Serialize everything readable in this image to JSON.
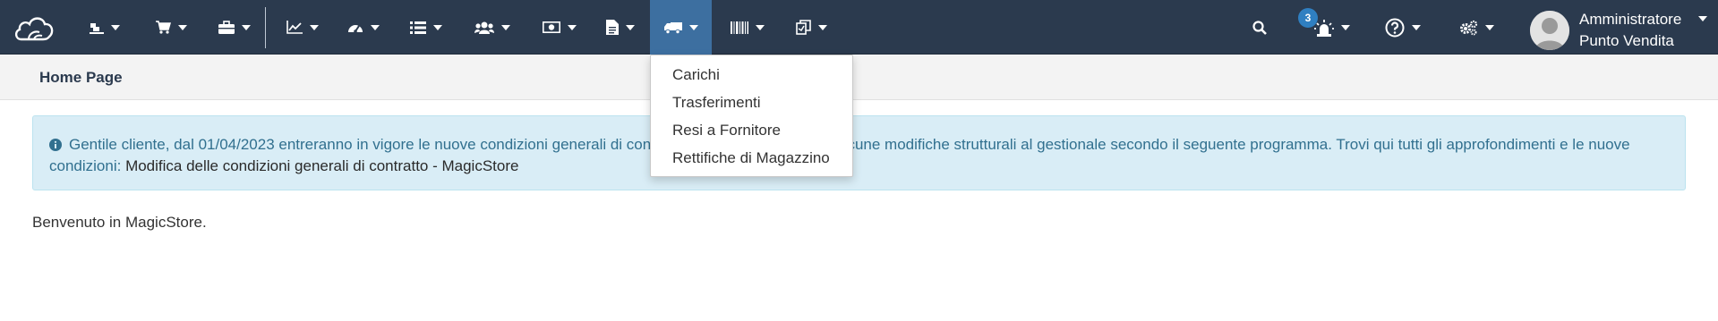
{
  "navbar": {
    "bg_color": "#2b3a4e",
    "active_color": "#3d6fa0",
    "logo_icon": "cloud-logo-icon",
    "items": [
      {
        "icon": "conveyor-icon"
      },
      {
        "icon": "shopping-cart-icon"
      },
      {
        "icon": "briefcase-icon"
      },
      {
        "icon": "line-chart-icon"
      },
      {
        "icon": "dashboard-gauge-icon"
      },
      {
        "icon": "list-icon"
      },
      {
        "icon": "users-icon"
      },
      {
        "icon": "money-bill-icon"
      },
      {
        "icon": "document-icon"
      },
      {
        "icon": "truck-icon",
        "active": true
      },
      {
        "icon": "barcode-icon"
      },
      {
        "icon": "clipboard-copy-icon"
      }
    ],
    "right_items": [
      {
        "icon": "search-icon"
      },
      {
        "icon": "alarm-light-icon",
        "badge": "3"
      },
      {
        "icon": "help-circle-icon"
      },
      {
        "icon": "gears-icon"
      }
    ],
    "user": {
      "role": "Amministratore",
      "store": "Punto Vendita"
    }
  },
  "breadcrumb": {
    "title": "Home Page"
  },
  "alert": {
    "text": "Gentile cliente, dal 01/04/2023 entreranno in vigore le nuove condizioni generali di contratto e verranno apportate alcune modifiche strutturali al gestionale secondo il seguente programma. Trovi qui tutti gli approfondimenti e le nuove condizioni: ",
    "link_text": "Modifica delle condizioni generali di contratto - MagicStore"
  },
  "welcome": "Benvenuto in MagicStore.",
  "dropdown": {
    "items": [
      {
        "label": "Carichi"
      },
      {
        "label": "Trasferimenti"
      },
      {
        "label": "Resi a Fornitore"
      },
      {
        "label": "Rettifiche di Magazzino"
      }
    ]
  }
}
